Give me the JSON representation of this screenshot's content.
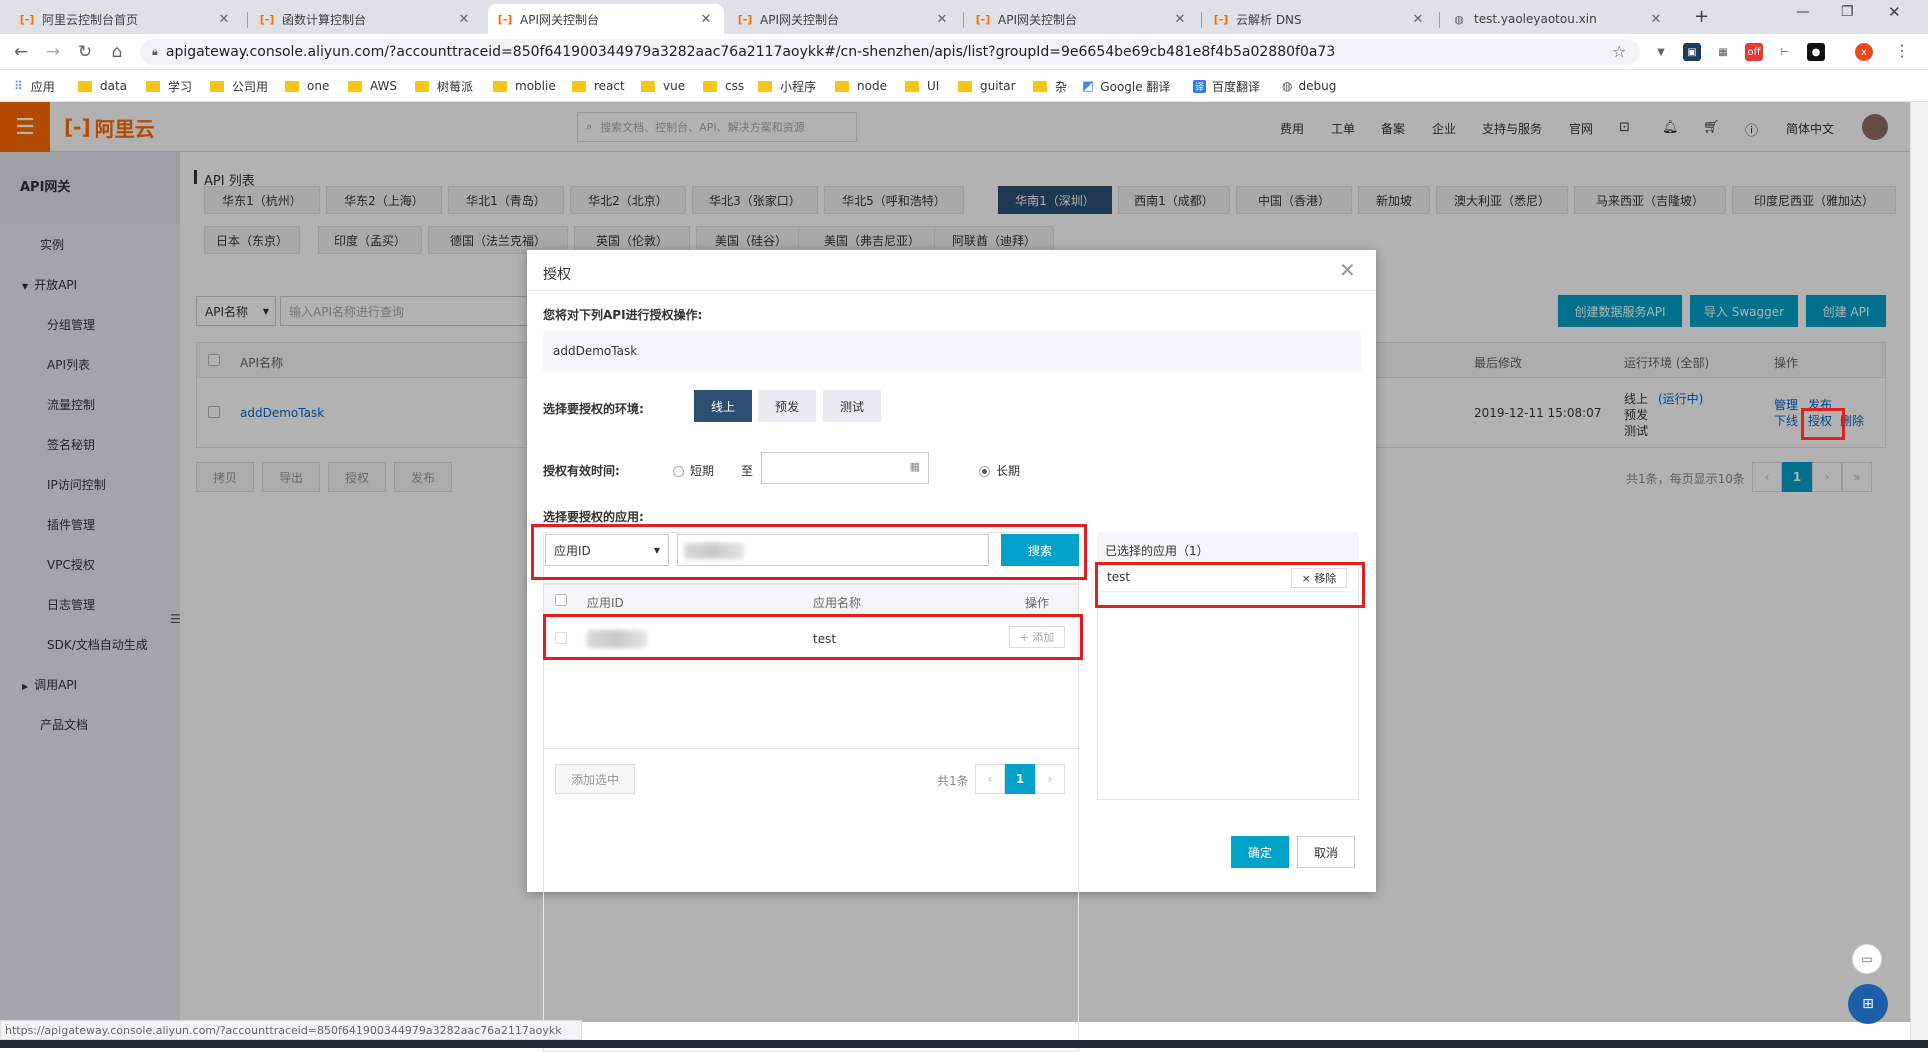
{
  "browser": {
    "tabs": [
      {
        "label": "阿里云控制台首页",
        "active": false
      },
      {
        "label": "函数计算控制台",
        "active": false
      },
      {
        "label": "API网关控制台",
        "active": true
      },
      {
        "label": "API网关控制台",
        "active": false
      },
      {
        "label": "API网关控制台",
        "active": false
      },
      {
        "label": "云解析 DNS",
        "active": false
      },
      {
        "label": "test.yaoleyaotou.xin",
        "active": false
      }
    ],
    "new_tab": "+",
    "url": "apigateway.console.aliyun.com/?accounttraceid=850f641900344979a3282aac76a2117aoykk#/cn-shenzhen/apis/list?groupId=9e6654be69cb481e8f4b5a02880f0a73",
    "bookmarks": [
      "应用",
      "data",
      "学习",
      "公司用",
      "one",
      "AWS",
      "树莓派",
      "moblie",
      "react",
      "vue",
      "css",
      "小程序",
      "node",
      "UI",
      "guitar",
      "杂",
      "Google 翻译",
      "百度翻译",
      "debug"
    ]
  },
  "topnav": {
    "logo": "阿里云",
    "search_placeholder": "搜索文档、控制台、API、解决方案和资源",
    "items": [
      "费用",
      "工单",
      "备案",
      "企业",
      "支持与服务",
      "官网"
    ],
    "lang": "简体中文"
  },
  "sidebar": {
    "title": "API网关",
    "items": [
      "实例",
      "开放API",
      "分组管理",
      "API列表",
      "流量控制",
      "签名秘钥",
      "IP访问控制",
      "插件管理",
      "VPC授权",
      "日志管理",
      "SDK/文档自动生成",
      "调用API",
      "产品文档"
    ]
  },
  "main": {
    "title": "API 列表",
    "regions_row1": [
      "华东1（杭州）",
      "华东2（上海）",
      "华北1（青岛）",
      "华北2（北京）",
      "华北3（张家口）",
      "华北5（呼和浩特）",
      "华南1（深圳）",
      "西南1（成都）",
      "中国（香港）",
      "新加坡",
      "澳大利亚（悉尼）",
      "马来西亚（吉隆坡）",
      "印度尼西亚（雅加达）"
    ],
    "regions_row2": [
      "日本（东京）",
      "印度（孟买）",
      "德国（法兰克福）",
      "英国（伦敦）",
      "美国（硅谷）",
      "美国（弗吉尼亚）",
      "阿联酋（迪拜）"
    ],
    "selected_region": "华南1（深圳）",
    "filter_select": "API名称",
    "filter_placeholder": "输入API名称进行查询",
    "buttons": {
      "create_data_api": "创建数据服务API",
      "import_swagger": "导入 Swagger",
      "create_api": "创建 API"
    },
    "table_headers": {
      "name": "API名称",
      "modified": "最后修改",
      "env": "运行环境 (全部)",
      "ops": "操作"
    },
    "row": {
      "name": "addDemoTask",
      "modified": "2019-12-11 15:08:07",
      "env_online": "线上",
      "env_running": "(运行中)",
      "env_pre": "预发",
      "env_test": "测试",
      "ops": [
        "管理",
        "发布",
        "下线",
        "授权",
        "删除"
      ]
    },
    "bulk_buttons": [
      "拷贝",
      "导出",
      "授权",
      "发布"
    ],
    "pagination_text": "共1条，每页显示10条",
    "page": "1"
  },
  "dialog": {
    "title": "授权",
    "api_label": "您将对下列API进行授权操作:",
    "api_name": "addDemoTask",
    "env_label": "选择要授权的环境:",
    "envs": [
      "线上",
      "预发",
      "测试"
    ],
    "validity_label": "授权有效时间:",
    "short_term": "短期",
    "to": "至",
    "long_term": "长期",
    "app_label": "选择要授权的应用:",
    "search_select": "应用ID",
    "search_button": "搜索",
    "list_headers": {
      "app_id": "应用ID",
      "app_name": "应用名称",
      "action": "操作"
    },
    "app_row": {
      "name": "test",
      "add": "+ 添加"
    },
    "add_selected": "添加选中",
    "list_total": "共1条",
    "list_page": "1",
    "selected_title": "已选择的应用（1）",
    "selected_item": "test",
    "remove": "× 移除",
    "confirm": "确定",
    "cancel": "取消"
  },
  "statusbar": "https://apigateway.console.aliyun.com/?accounttraceid=850f641900344979a3282aac76a2117aoykk"
}
